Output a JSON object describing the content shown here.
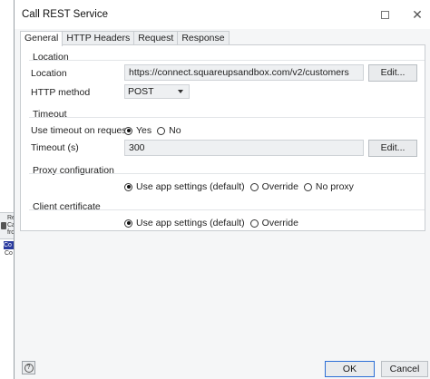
{
  "window": {
    "title": "Call REST Service"
  },
  "tabs": [
    {
      "label": "General",
      "active": true
    },
    {
      "label": "HTTP Headers",
      "active": false
    },
    {
      "label": "Request",
      "active": false
    },
    {
      "label": "Response",
      "active": false
    }
  ],
  "location_section": {
    "title": "Location",
    "location_label": "Location",
    "location_value": "https://connect.squareupsandbox.com/v2/customers",
    "edit_label": "Edit...",
    "method_label": "HTTP method",
    "method_value": "POST"
  },
  "timeout_section": {
    "title": "Timeout",
    "use_timeout_label": "Use timeout on request",
    "yes_label": "Yes",
    "no_label": "No",
    "use_timeout_value": "Yes",
    "timeout_label": "Timeout (s)",
    "timeout_value": "300",
    "edit_label": "Edit..."
  },
  "proxy_section": {
    "title": "Proxy configuration",
    "options": [
      "Use app settings (default)",
      "Override",
      "No proxy"
    ],
    "selected": "Use app settings (default)"
  },
  "certificate_section": {
    "title": "Client certificate",
    "options": [
      "Use app settings (default)",
      "Override"
    ],
    "selected": "Use app settings (default)"
  },
  "footer": {
    "ok_label": "OK",
    "cancel_label": "Cancel"
  },
  "background": {
    "fragment_text": "Re Ca fro",
    "selected_text": "Co",
    "below_text": "Co"
  },
  "colors": {
    "accent": "#2b6ed6",
    "selection": "#2a3b9f"
  }
}
